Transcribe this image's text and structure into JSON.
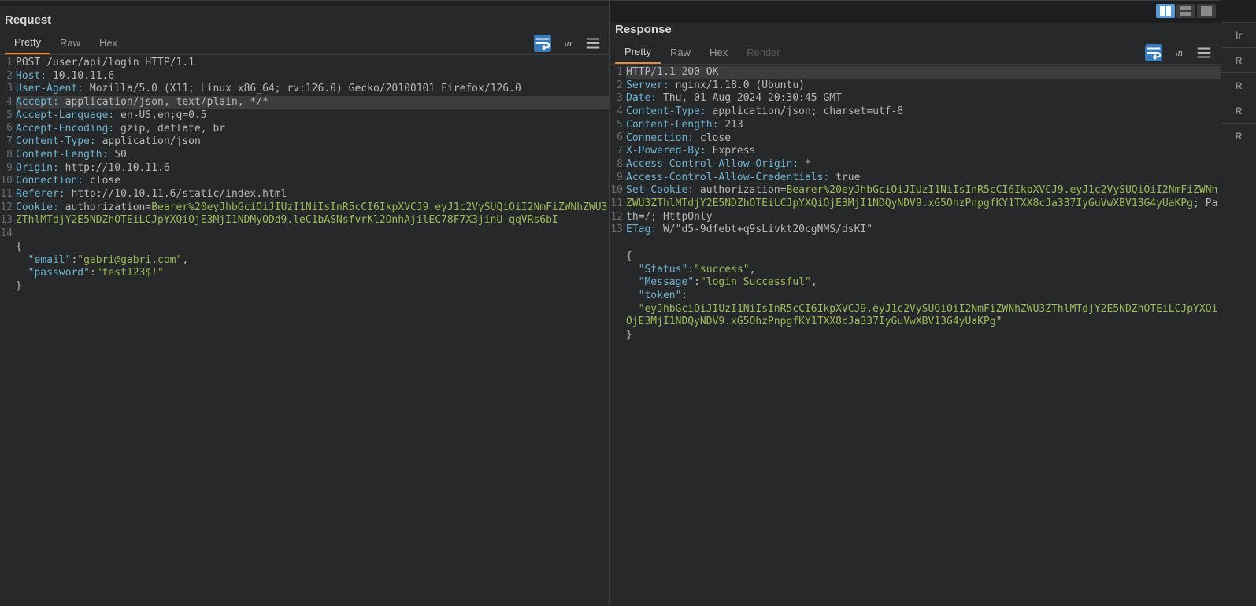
{
  "request": {
    "title": "Request",
    "tabs": [
      "Pretty",
      "Raw",
      "Hex"
    ],
    "activeTab": 0,
    "lines": [
      {
        "n": 1,
        "type": "startline",
        "segments": [
          {
            "t": "POST /user/api/login HTTP/1.1",
            "c": "val"
          }
        ]
      },
      {
        "n": 2,
        "type": "header",
        "segments": [
          {
            "t": "Host:",
            "c": "key"
          },
          {
            "t": " 10.10.11.6",
            "c": "val"
          }
        ]
      },
      {
        "n": 3,
        "type": "header",
        "segments": [
          {
            "t": "User-Agent:",
            "c": "key"
          },
          {
            "t": " Mozilla/5.0 (X11; Linux x86_64; rv:126.0) Gecko/20100101 Firefox/126.0",
            "c": "val"
          }
        ]
      },
      {
        "n": 4,
        "type": "header",
        "hl": true,
        "segments": [
          {
            "t": "Accept:",
            "c": "key"
          },
          {
            "t": " application/json, text/plain, */*",
            "c": "val"
          }
        ]
      },
      {
        "n": 5,
        "type": "header",
        "segments": [
          {
            "t": "Accept-Language:",
            "c": "key"
          },
          {
            "t": " en-US,en;q=0.5",
            "c": "val"
          }
        ]
      },
      {
        "n": 6,
        "type": "header",
        "segments": [
          {
            "t": "Accept-Encoding:",
            "c": "key"
          },
          {
            "t": " gzip, deflate, br",
            "c": "val"
          }
        ]
      },
      {
        "n": 7,
        "type": "header",
        "segments": [
          {
            "t": "Content-Type:",
            "c": "key"
          },
          {
            "t": " application/json",
            "c": "val"
          }
        ]
      },
      {
        "n": 8,
        "type": "header",
        "segments": [
          {
            "t": "Content-Length:",
            "c": "key"
          },
          {
            "t": " 50",
            "c": "val"
          }
        ]
      },
      {
        "n": 9,
        "type": "header",
        "segments": [
          {
            "t": "Origin:",
            "c": "key"
          },
          {
            "t": " http://10.10.11.6",
            "c": "val"
          }
        ]
      },
      {
        "n": 10,
        "type": "header",
        "segments": [
          {
            "t": "Connection:",
            "c": "key"
          },
          {
            "t": " close",
            "c": "val"
          }
        ]
      },
      {
        "n": 11,
        "type": "header",
        "segments": [
          {
            "t": "Referer:",
            "c": "key"
          },
          {
            "t": " http://10.10.11.6/static/index.html",
            "c": "val"
          }
        ]
      },
      {
        "n": 12,
        "type": "cookie",
        "segments": [
          {
            "t": "Cookie:",
            "c": "key"
          },
          {
            "t": " authorization=",
            "c": "val"
          },
          {
            "t": "Bearer%20eyJhbGciOiJIUzI1NiIsInR5cCI6IkpXVCJ9.eyJ1c2VySUQiOiI2NmFiZWNhZWU3ZThlMTdjY2E5NDZhOTEiLCJpYXQiOjE3MjI1NDMyODd9.leC1bASNsfvrKl2OnhAjilEC78F7X3jinU-qqVRs6bI",
            "c": "token"
          }
        ]
      },
      {
        "n": 13,
        "type": "blank",
        "segments": []
      },
      {
        "n": 14,
        "type": "body",
        "segments": [
          {
            "t": "{",
            "c": "val",
            "br": true
          },
          {
            "t": "  \"email\"",
            "c": "key"
          },
          {
            "t": ":",
            "c": "val"
          },
          {
            "t": "\"gabri@gabri.com\"",
            "c": "string"
          },
          {
            "t": ",",
            "c": "val",
            "br": true
          },
          {
            "t": "  \"password\"",
            "c": "key"
          },
          {
            "t": ":",
            "c": "val"
          },
          {
            "t": "\"test123$!\"",
            "c": "string",
            "br": true
          },
          {
            "t": "}",
            "c": "val"
          }
        ]
      }
    ]
  },
  "response": {
    "title": "Response",
    "tabs": [
      "Pretty",
      "Raw",
      "Hex",
      "Render"
    ],
    "activeTab": 0,
    "disabledTabs": [
      3
    ],
    "lines": [
      {
        "n": 1,
        "type": "startline",
        "hl": true,
        "segments": [
          {
            "t": "HTTP/1.1 200 OK",
            "c": "val"
          }
        ]
      },
      {
        "n": 2,
        "type": "header",
        "segments": [
          {
            "t": "Server:",
            "c": "key"
          },
          {
            "t": " nginx/1.18.0 (Ubuntu)",
            "c": "val"
          }
        ]
      },
      {
        "n": 3,
        "type": "header",
        "segments": [
          {
            "t": "Date:",
            "c": "key"
          },
          {
            "t": " Thu, 01 Aug 2024 20:30:45 GMT",
            "c": "val"
          }
        ]
      },
      {
        "n": 4,
        "type": "header",
        "segments": [
          {
            "t": "Content-Type:",
            "c": "key"
          },
          {
            "t": " application/json; charset=utf-8",
            "c": "val"
          }
        ]
      },
      {
        "n": 5,
        "type": "header",
        "segments": [
          {
            "t": "Content-Length:",
            "c": "key"
          },
          {
            "t": " 213",
            "c": "val"
          }
        ]
      },
      {
        "n": 6,
        "type": "header",
        "segments": [
          {
            "t": "Connection:",
            "c": "key"
          },
          {
            "t": " close",
            "c": "val"
          }
        ]
      },
      {
        "n": 7,
        "type": "header",
        "segments": [
          {
            "t": "X-Powered-By:",
            "c": "key"
          },
          {
            "t": " Express",
            "c": "val"
          }
        ]
      },
      {
        "n": 8,
        "type": "header",
        "segments": [
          {
            "t": "Access-Control-Allow-Origin:",
            "c": "key"
          },
          {
            "t": " *",
            "c": "val"
          }
        ]
      },
      {
        "n": 9,
        "type": "header",
        "segments": [
          {
            "t": "Access-Control-Allow-Credentials:",
            "c": "key"
          },
          {
            "t": " true",
            "c": "val"
          }
        ]
      },
      {
        "n": 10,
        "type": "setcookie",
        "segments": [
          {
            "t": "Set-Cookie:",
            "c": "key"
          },
          {
            "t": " authorization=",
            "c": "setcookie"
          },
          {
            "t": "Bearer%20eyJhbGciOiJIUzI1NiIsInR5cCI6IkpXVCJ9.eyJ1c2VySUQiOiI2NmFiZWNhZWU3ZThlMTdjY2E5NDZhOTEiLCJpYXQiOjE3MjI1NDQyNDV9.xG5OhzPnpgfKY1TXX8cJa337IyGuVwXBV13G4yUaKPg",
            "c": "token"
          },
          {
            "t": "; Path=/; HttpOnly",
            "c": "setcookie"
          }
        ]
      },
      {
        "n": 11,
        "type": "header",
        "segments": [
          {
            "t": "ETag:",
            "c": "key"
          },
          {
            "t": " W/\"d5-9dfebt+q9sLivkt20cgNMS/dsKI\"",
            "c": "val"
          }
        ]
      },
      {
        "n": 12,
        "type": "blank",
        "segments": []
      },
      {
        "n": 13,
        "type": "body",
        "segments": [
          {
            "t": "{",
            "c": "val",
            "br": true
          },
          {
            "t": "  \"Status\"",
            "c": "key"
          },
          {
            "t": ":",
            "c": "val"
          },
          {
            "t": "\"success\"",
            "c": "string"
          },
          {
            "t": ",",
            "c": "val",
            "br": true
          },
          {
            "t": "  \"Message\"",
            "c": "key"
          },
          {
            "t": ":",
            "c": "val"
          },
          {
            "t": "\"login Successful\"",
            "c": "string"
          },
          {
            "t": ",",
            "c": "val",
            "br": true
          },
          {
            "t": "  \"token\"",
            "c": "key"
          },
          {
            "t": ":",
            "c": "val",
            "br": true
          },
          {
            "t": "  \"eyJhbGciOiJIUzI1NiIsInR5cCI6IkpXVCJ9.eyJ1c2VySUQiOiI2NmFiZWNhZWU3ZThlMTdjY2E5NDZhOTEiLCJpYXQiOjE3MjI1NDQyNDV9.xG5OhzPnpgfKY1TXX8cJa337IyGuVwXBV13G4yUaKPg\"",
            "c": "string",
            "br": true
          },
          {
            "t": "}",
            "c": "val"
          }
        ]
      }
    ]
  },
  "sidebar": {
    "items": [
      "Ir",
      "R",
      "R",
      "R",
      "R"
    ]
  }
}
